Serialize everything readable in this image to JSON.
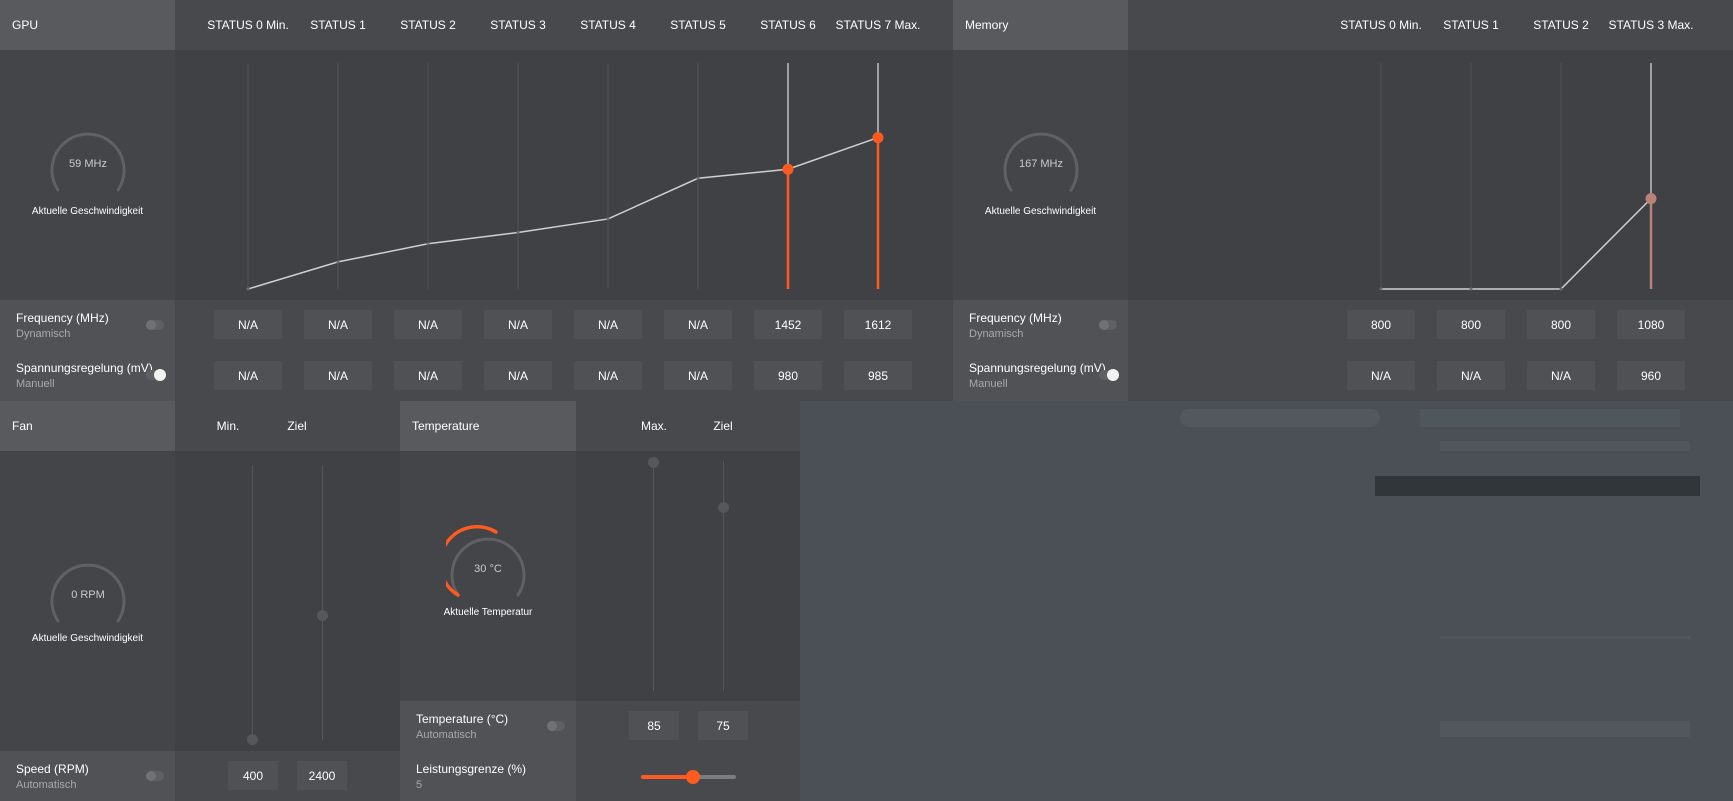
{
  "gpu": {
    "title": "GPU",
    "states": [
      "STATUS 0 Min.",
      "STATUS 1",
      "STATUS 2",
      "STATUS 3",
      "STATUS 4",
      "STATUS 5",
      "STATUS 6",
      "STATUS 7 Max."
    ],
    "gauge_value": "59 MHz",
    "gauge_caption": "Aktuelle Geschwindigkeit",
    "freq_label": "Frequency (MHz)",
    "freq_mode": "Dynamisch",
    "volt_label": "Spannungsregelung (mV)",
    "volt_mode": "Manuell",
    "freq_values": [
      "N/A",
      "N/A",
      "N/A",
      "N/A",
      "N/A",
      "N/A",
      "1452",
      "1612"
    ],
    "volt_values": [
      "N/A",
      "N/A",
      "N/A",
      "N/A",
      "N/A",
      "N/A",
      "980",
      "985"
    ],
    "freq_toggle_on": false,
    "volt_toggle_on": true,
    "curve_levels": [
      0.0,
      0.12,
      0.2,
      0.25,
      0.31,
      0.49,
      0.53,
      0.67
    ],
    "active_states": [
      6,
      7
    ]
  },
  "memory": {
    "title": "Memory",
    "states": [
      "STATUS 0 Min.",
      "STATUS 1",
      "STATUS 2",
      "STATUS 3 Max."
    ],
    "gauge_value": "167 MHz",
    "gauge_caption": "Aktuelle Geschwindigkeit",
    "freq_label": "Frequency (MHz)",
    "freq_mode": "Dynamisch",
    "volt_label": "Spannungsregelung (mV)",
    "volt_mode": "Manuell",
    "freq_values": [
      "800",
      "800",
      "800",
      "1080"
    ],
    "volt_values": [
      "N/A",
      "N/A",
      "N/A",
      "960"
    ],
    "freq_toggle_on": false,
    "volt_toggle_on": true,
    "curve_levels": [
      0.0,
      0.0,
      0.0,
      0.4
    ],
    "active_states": [
      3
    ]
  },
  "fan": {
    "title": "Fan",
    "col_min": "Min.",
    "col_target": "Ziel",
    "gauge_value": "0 RPM",
    "gauge_caption": "Aktuelle Geschwindigkeit",
    "speed_label": "Speed (RPM)",
    "speed_mode": "Automatisch",
    "min_value": "400",
    "target_value": "2400",
    "speed_toggle_on": false
  },
  "temperature": {
    "title": "Temperature",
    "col_max": "Max.",
    "col_target": "Ziel",
    "gauge_value": "30 °C",
    "gauge_caption": "Aktuelle Temperatur",
    "temp_label": "Temperature (°C)",
    "temp_mode": "Automatisch",
    "max_value": "85",
    "target_value": "75",
    "power_label": "Leistungsgrenze (%)",
    "power_value": "5",
    "power_fraction": 0.55,
    "temp_toggle_on": false
  },
  "colors": {
    "accent": "#ff5a1f",
    "line": "#cfd0d2",
    "memory_point": "#b98377"
  }
}
